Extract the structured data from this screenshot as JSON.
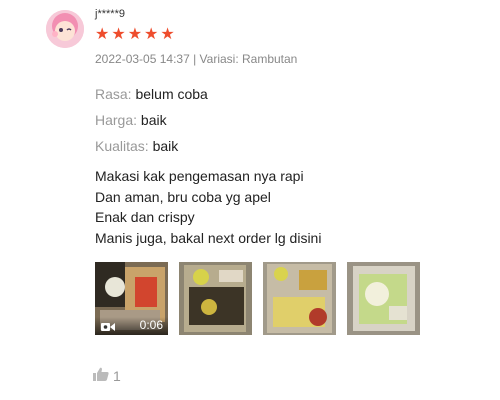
{
  "review": {
    "username": "j*****9",
    "rating": 5,
    "meta": "2022-03-05 14:37 | Variasi: Rambutan",
    "attributes": [
      {
        "key": "Rasa:",
        "value": "belum coba"
      },
      {
        "key": "Harga:",
        "value": "baik"
      },
      {
        "key": "Kualitas:",
        "value": "baik"
      }
    ],
    "lines": [
      "Makasi kak pengemasan nya rapi",
      "Dan aman, bru coba yg apel",
      "Enak dan crispy",
      "Manis juga, bakal next order lg disini"
    ],
    "media": {
      "video_duration": "0:06"
    },
    "likes": "1"
  },
  "icons": {
    "star": "star-icon",
    "video": "video-camera-icon",
    "like": "thumbs-up-icon"
  },
  "colors": {
    "star": "#ee4d2d",
    "muted": "#999999"
  }
}
